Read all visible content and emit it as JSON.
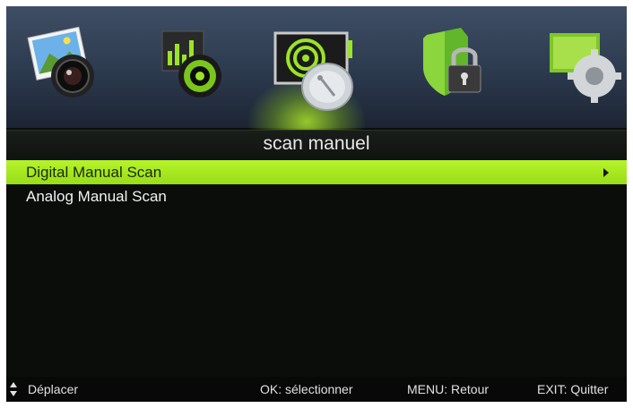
{
  "menu_title": "scan manuel",
  "icons": [
    {
      "name": "picture-icon"
    },
    {
      "name": "sound-icon"
    },
    {
      "name": "channel-scan-icon"
    },
    {
      "name": "lock-icon"
    },
    {
      "name": "settings-icon"
    }
  ],
  "selected_icon_index": 2,
  "items": [
    {
      "label": "Digital Manual Scan",
      "selected": true,
      "has_submenu": true
    },
    {
      "label": "Analog Manual Scan",
      "selected": false,
      "has_submenu": false
    }
  ],
  "footer": {
    "move": "Déplacer",
    "ok": "OK: sélectionner",
    "menu": "MENU: Retour",
    "exit": "EXIT: Quitter"
  },
  "colors": {
    "highlight": "#a8e820",
    "background": "#0b0d0b",
    "icon_band": "#344257"
  }
}
